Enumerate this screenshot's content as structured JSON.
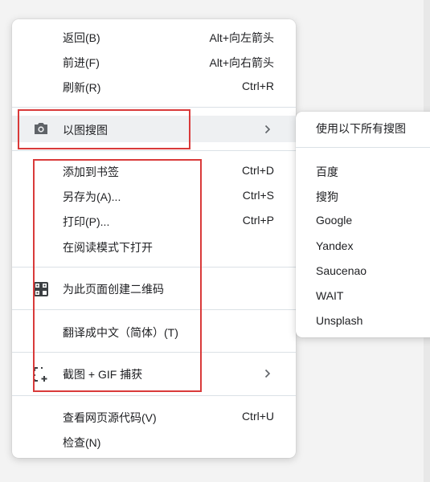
{
  "menu": {
    "group1": [
      {
        "label": "返回(B)",
        "shortcut": "Alt+向左箭头"
      },
      {
        "label": "前进(F)",
        "shortcut": "Alt+向右箭头"
      },
      {
        "label": "刷新(R)",
        "shortcut": "Ctrl+R"
      }
    ],
    "image_search": {
      "label": "以图搜图",
      "icon": "camera-icon"
    },
    "group2": [
      {
        "label": "添加到书签",
        "shortcut": "Ctrl+D"
      },
      {
        "label": "另存为(A)...",
        "shortcut": "Ctrl+S"
      },
      {
        "label": "打印(P)...",
        "shortcut": "Ctrl+P"
      },
      {
        "label": "在阅读模式下打开",
        "shortcut": ""
      }
    ],
    "qr": {
      "label": "为此页面创建二维码",
      "icon": "qr-code-icon"
    },
    "translate": {
      "label": "翻译成中文（简体）(T)"
    },
    "screenshot": {
      "label": "截图 + GIF 捕获",
      "icon": "screenshot-crop-icon"
    },
    "group3": [
      {
        "label": "查看网页源代码(V)",
        "shortcut": "Ctrl+U"
      },
      {
        "label": "检查(N)",
        "shortcut": ""
      }
    ]
  },
  "submenu": {
    "all": "使用以下所有搜图",
    "engines": [
      "百度",
      "搜狗",
      "Google",
      "Yandex",
      "Saucenao",
      "WAIT",
      "Unsplash"
    ]
  },
  "colors": {
    "annotation_box": "#d93a3a",
    "highlight": "#eef0f2"
  }
}
